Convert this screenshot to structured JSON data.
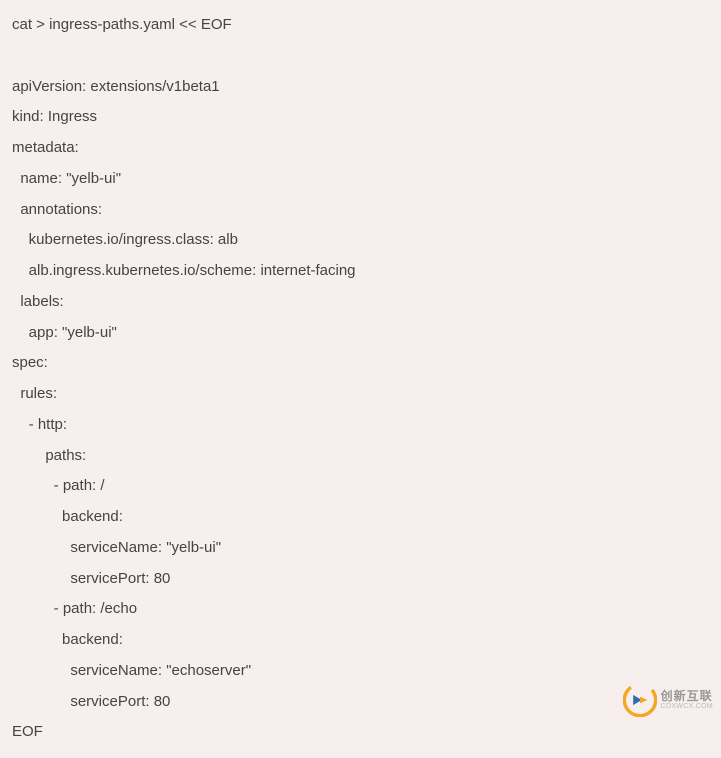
{
  "code": {
    "lines": [
      "cat > ingress-paths.yaml << EOF",
      "",
      "apiVersion: extensions/v1beta1",
      "kind: Ingress",
      "metadata:",
      "  name: \"yelb-ui\"",
      "  annotations:",
      "    kubernetes.io/ingress.class: alb",
      "    alb.ingress.kubernetes.io/scheme: internet-facing",
      "  labels:",
      "    app: \"yelb-ui\"",
      "spec:",
      "  rules:",
      "    - http:",
      "        paths:",
      "          - path: /",
      "            backend:",
      "              serviceName: \"yelb-ui\"",
      "              servicePort: 80",
      "          - path: /echo",
      "            backend:",
      "              serviceName: \"echoserver\"",
      "              servicePort: 80",
      "EOF"
    ]
  },
  "watermark": {
    "cn": "创新互联",
    "en": "CDXWCX.COM"
  }
}
